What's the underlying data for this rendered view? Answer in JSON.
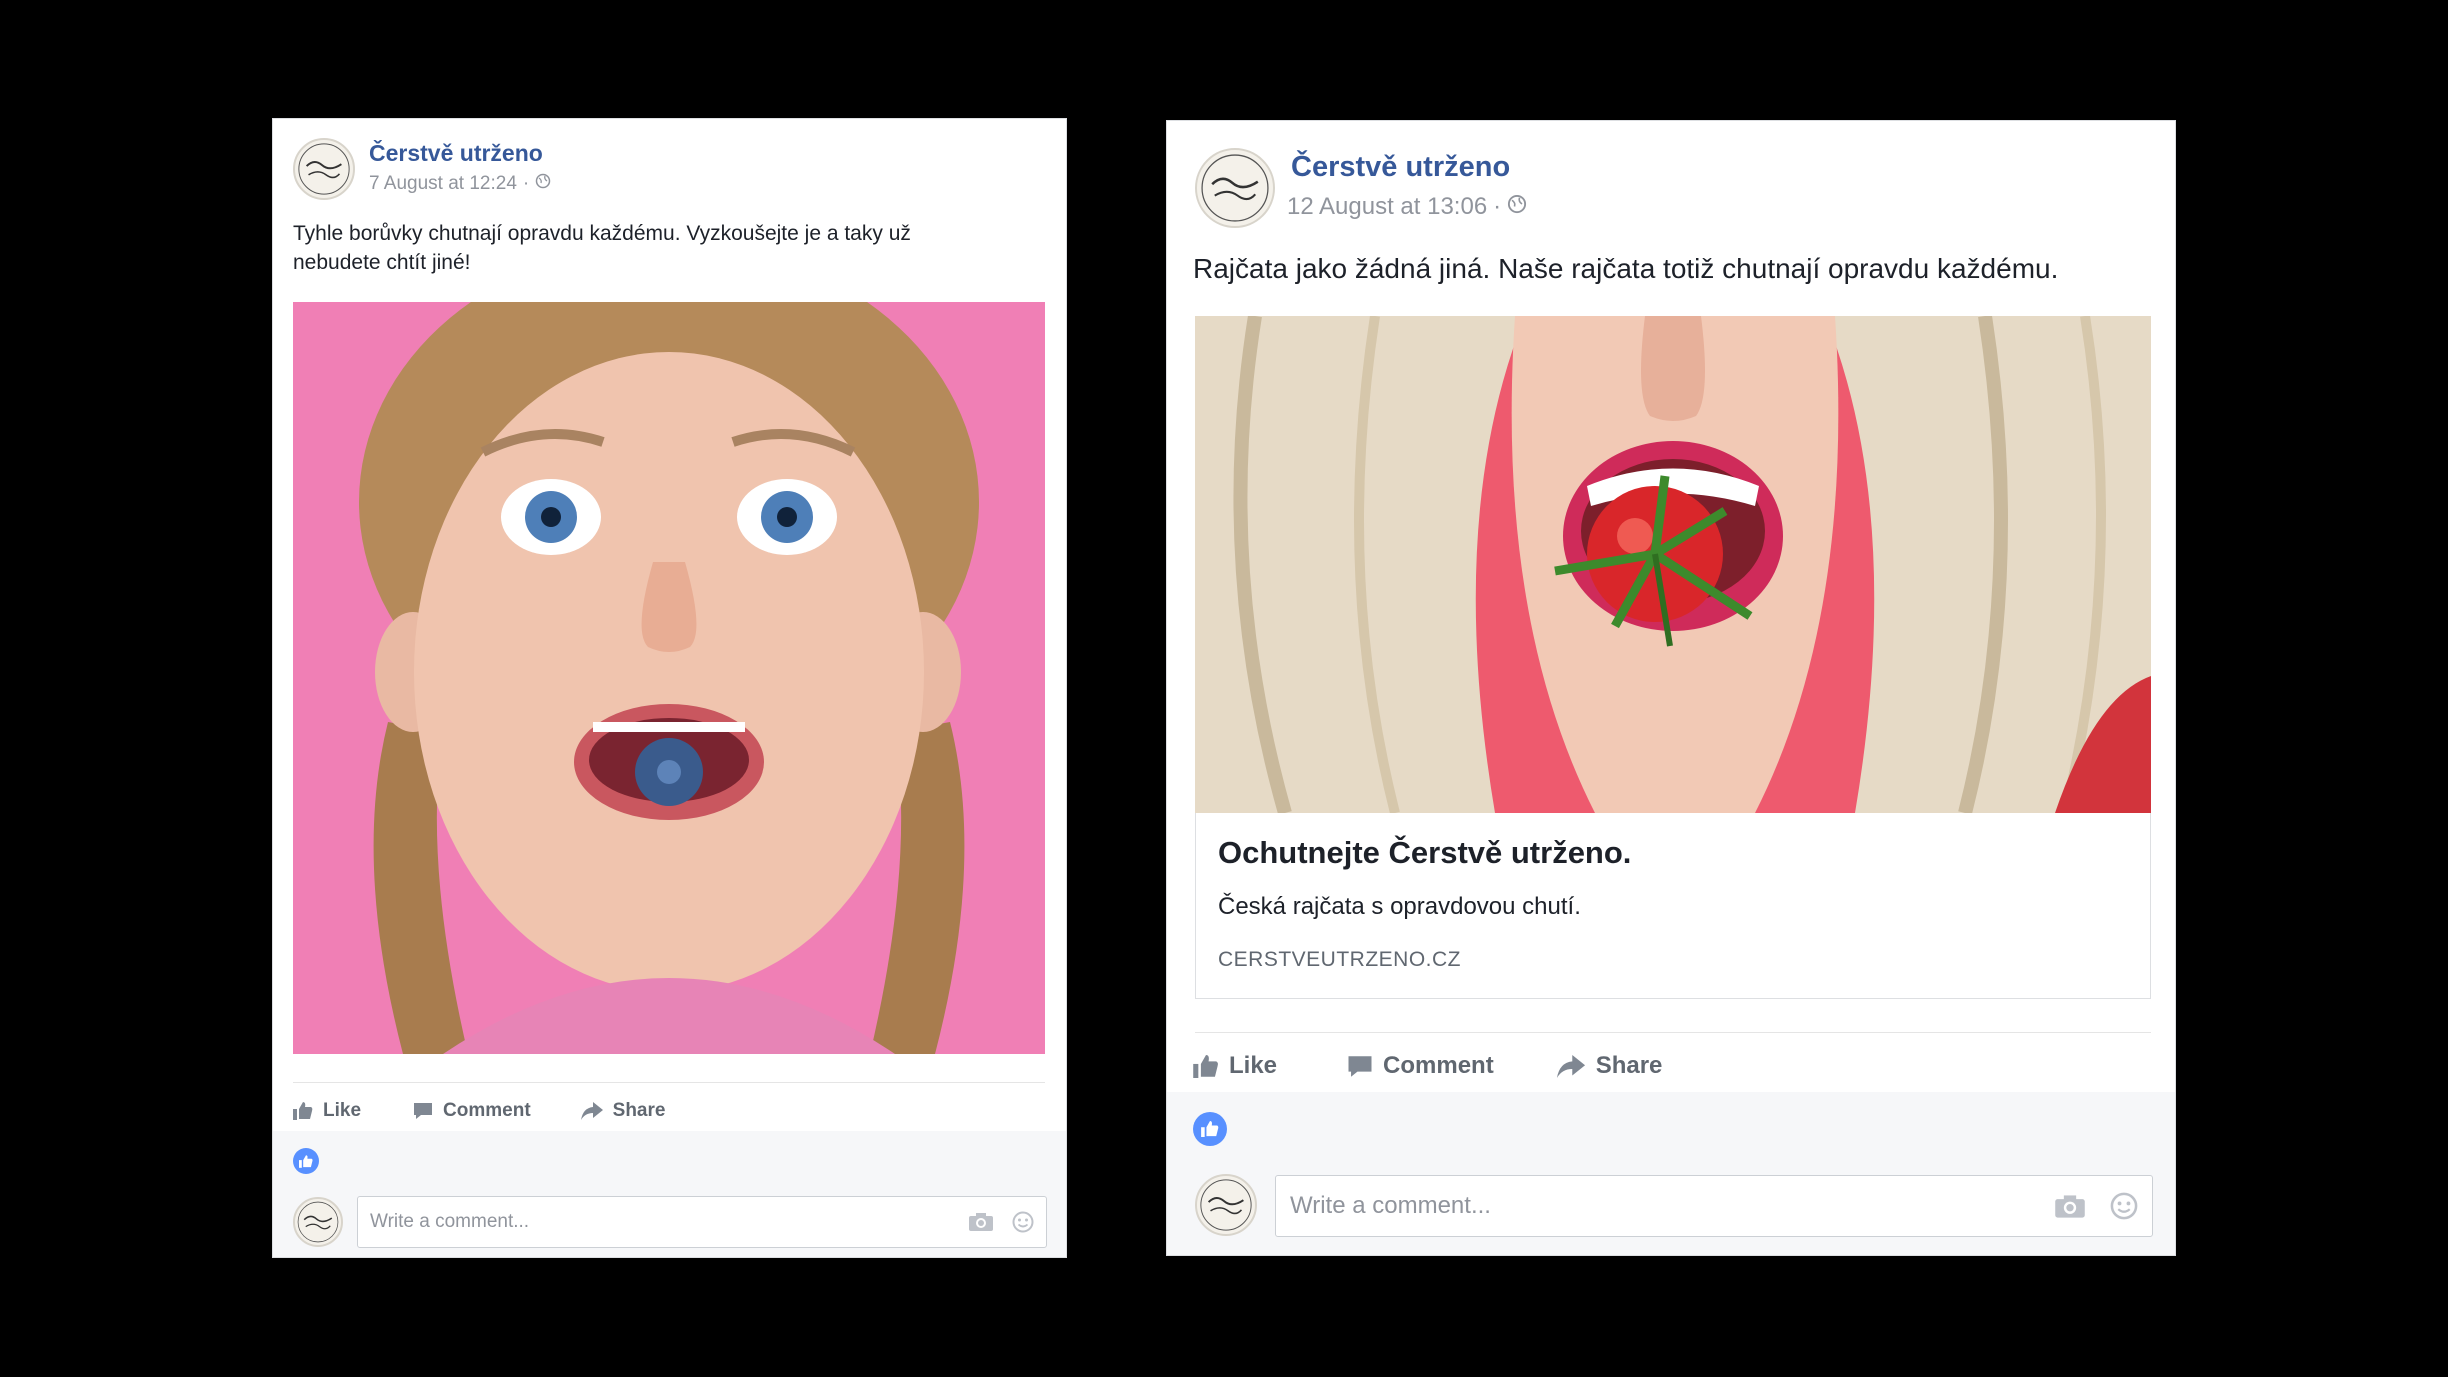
{
  "posts": [
    {
      "page_name": "Čerstvě utrženo",
      "date": "7 August at 12:24",
      "separator": "·",
      "text": "Tyhle borůvky chutnají opravdu každému. Vyzkoušejte je a taky už nebudete chtít jiné!",
      "photo_subject": "girl-with-blueberry",
      "actions": {
        "like": "Like",
        "comment": "Comment",
        "share": "Share"
      },
      "comment_placeholder": "Write a comment..."
    },
    {
      "page_name": "Čerstvě utrženo",
      "date": "12 August at 13:06",
      "separator": "·",
      "text": "Rajčata jako žádná jiná. Naše rajčata totiž chutnají opravdu každému.",
      "photo_subject": "woman-with-tomato",
      "link": {
        "title": "Ochutnejte Čerstvě utrženo.",
        "description": "Česká rajčata s opravdovou chutí.",
        "domain": "CERSTVEUTRZENO.CZ"
      },
      "actions": {
        "like": "Like",
        "comment": "Comment",
        "share": "Share"
      },
      "comment_placeholder": "Write a comment..."
    }
  ],
  "colors": {
    "page_background": "#000000",
    "link_blue": "#365899",
    "like_blue": "#5890ff",
    "photo_pink": "#f07fb5"
  },
  "icons": [
    "globe-icon",
    "like-icon",
    "comment-icon",
    "share-icon",
    "camera-icon",
    "smiley-icon"
  ]
}
